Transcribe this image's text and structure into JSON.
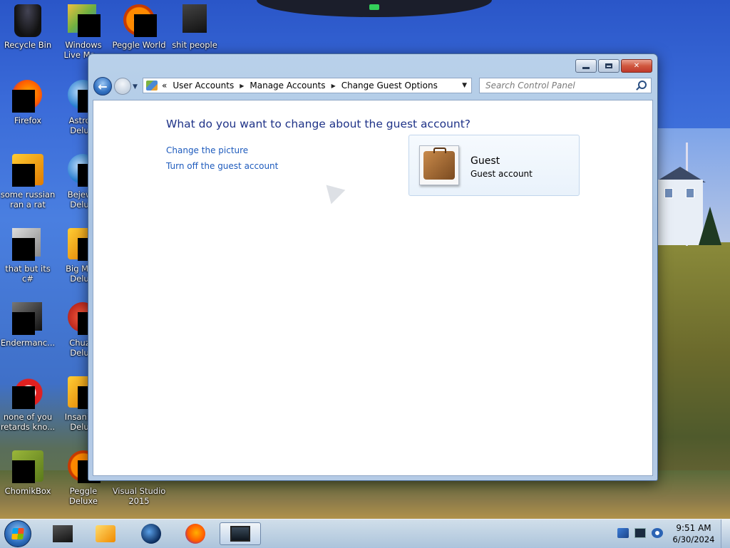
{
  "desktop": {
    "icons": [
      {
        "label": "Recycle Bin"
      },
      {
        "label": "Windows Live Ma..."
      },
      {
        "label": "Peggle World"
      },
      {
        "label": "shit people"
      },
      {
        "label": "Firefox"
      },
      {
        "label": "Astro... Delu..."
      },
      {
        "label": "some russian ran a rat"
      },
      {
        "label": "Bejew... Delu..."
      },
      {
        "label": "that but its c#"
      },
      {
        "label": "Big Mo... Delu..."
      },
      {
        "label": "Endermanc..."
      },
      {
        "label": "Chuz... Delu..."
      },
      {
        "label": "none of you retards kno..."
      },
      {
        "label": "Insaniq... Delu..."
      },
      {
        "label": "ChomikBox"
      },
      {
        "label": "Peggle Deluxe"
      },
      {
        "label": "Visual Studio 2015"
      }
    ]
  },
  "window": {
    "title_buttons": {
      "minimize": "minimize",
      "maximize": "maximize",
      "close": "close"
    },
    "address": {
      "overflow": "«",
      "crumbs": [
        "User Accounts",
        "Manage Accounts",
        "Change Guest Options"
      ]
    },
    "search": {
      "placeholder": "Search Control Panel"
    },
    "content": {
      "heading": "What do you want to change about the guest account?",
      "tasks": [
        "Change the picture",
        "Turn off the guest account"
      ],
      "account": {
        "name": "Guest",
        "type": "Guest account"
      }
    }
  },
  "taskbar": {
    "clock": {
      "time": "9:51 AM",
      "date": "6/30/2024"
    },
    "items": [
      "dark-app",
      "media-player",
      "globe-app",
      "firefox",
      "control-panel-window"
    ]
  }
}
